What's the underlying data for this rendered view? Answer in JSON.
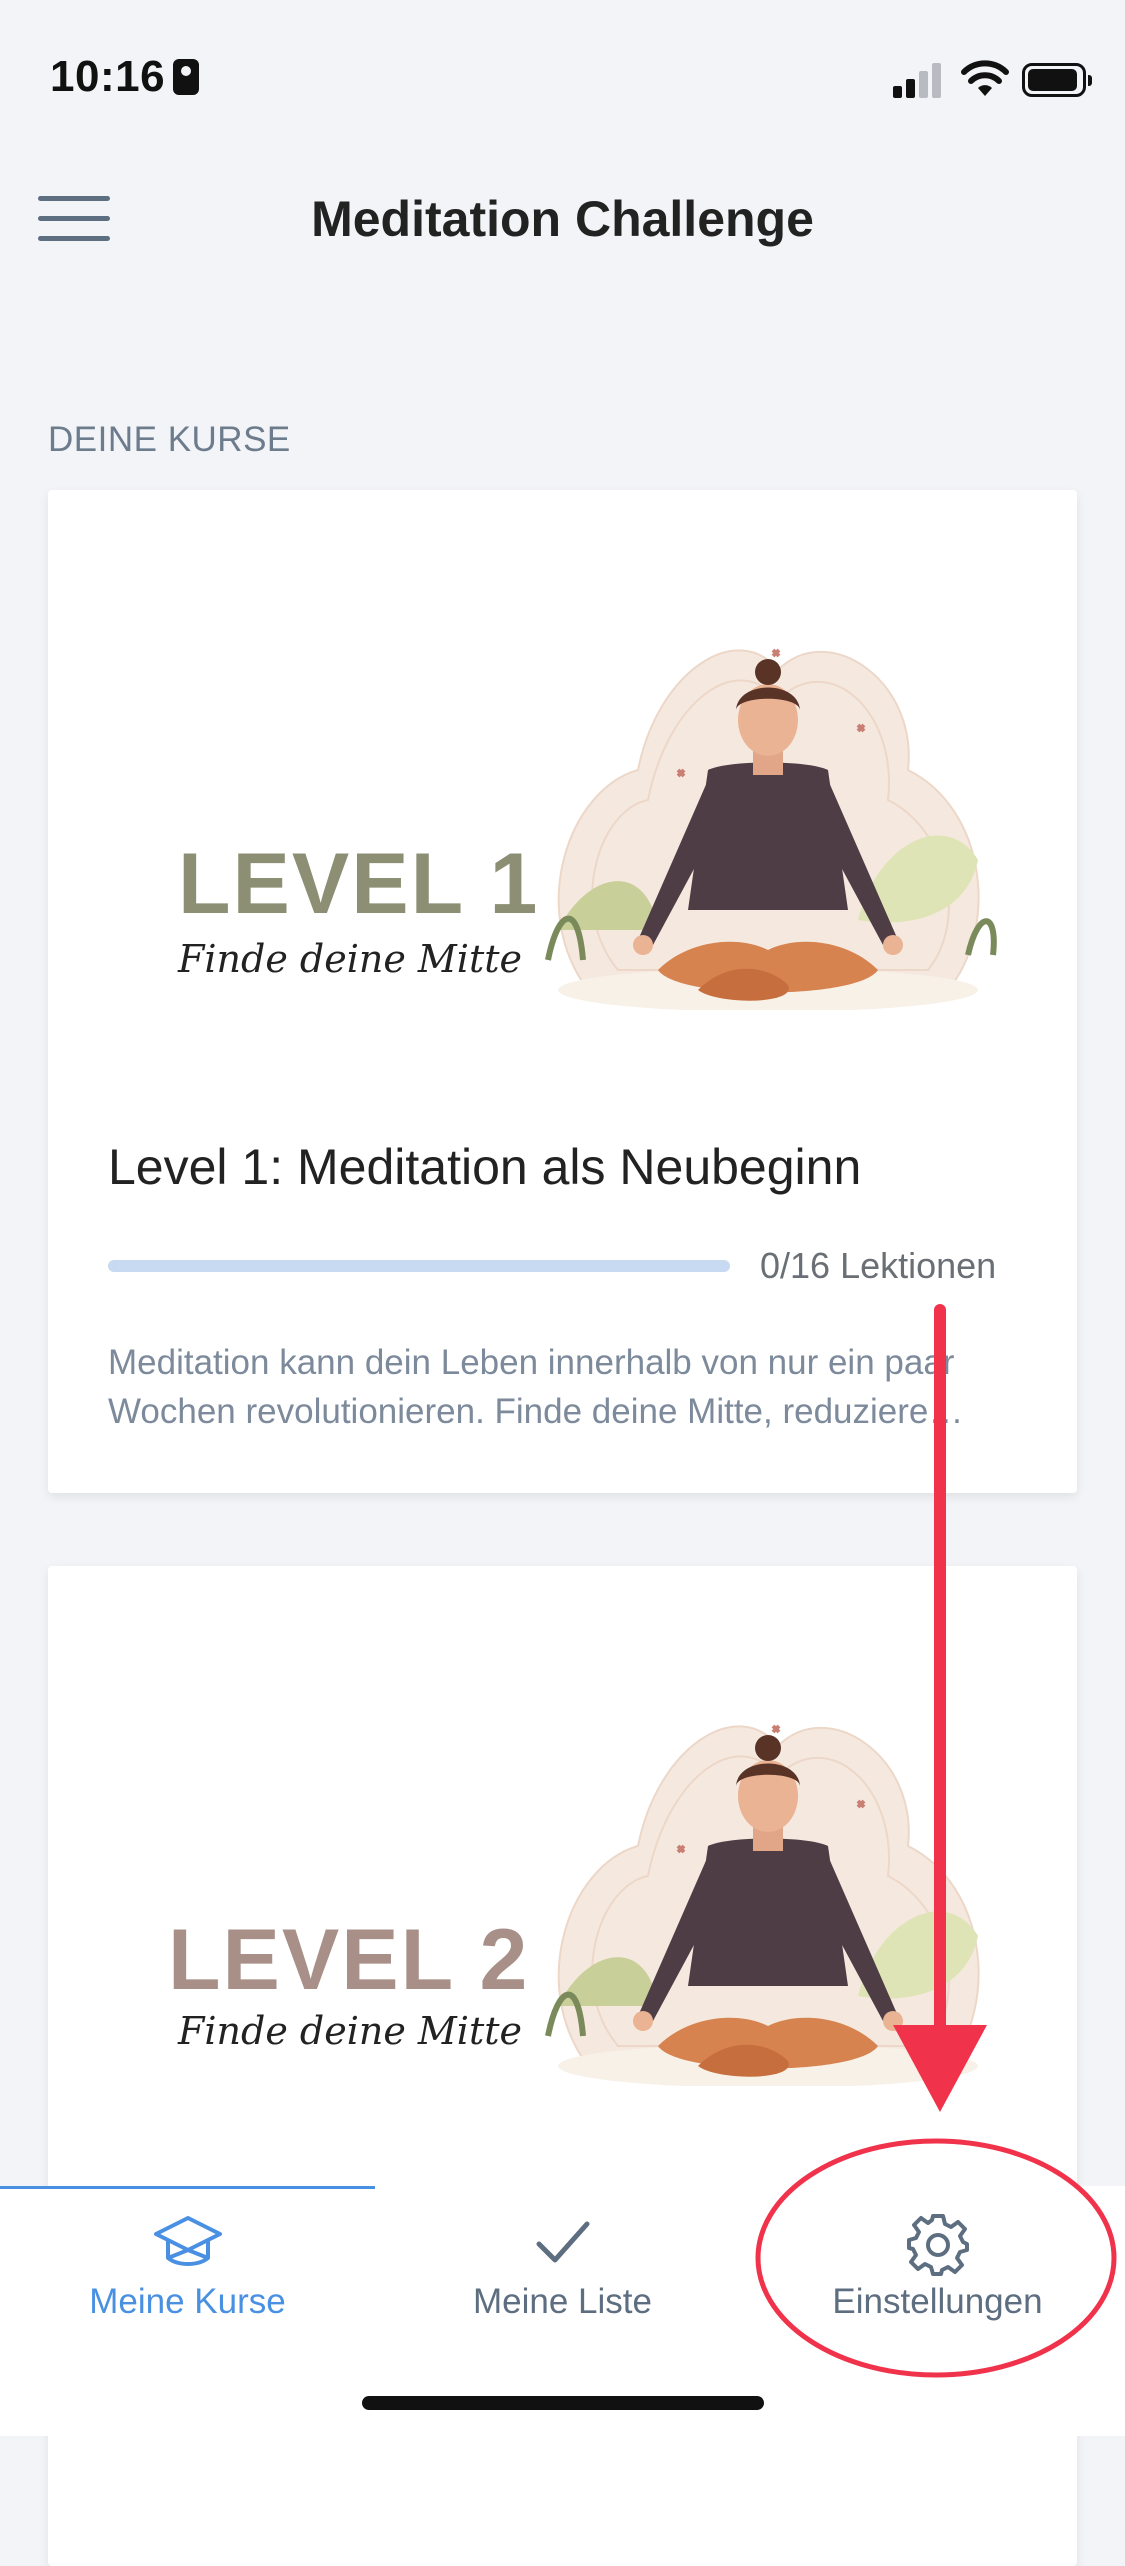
{
  "status_bar": {
    "time": "10:16"
  },
  "header": {
    "title": "Meditation Challenge"
  },
  "section": {
    "label": "DEINE KURSE"
  },
  "courses": [
    {
      "image_level": "LEVEL 1",
      "image_subtitle": "Finde deine Mitte",
      "level_color": "#8c8f74",
      "title": "Level 1: Meditation als Neubeginn",
      "progress_text": "0/16 Lektionen",
      "progress_fraction": 0,
      "description": "Meditation kann dein Leben innerhalb von nur ein paar Wochen revolutionieren. Finde deine Mitte, reduziere…"
    },
    {
      "image_level": "LEVEL 2",
      "image_subtitle": "Finde deine Mitte",
      "level_color": "#a89088"
    }
  ],
  "tabs": [
    {
      "label": "Meine Kurse",
      "icon": "graduation-cap-icon",
      "active": true
    },
    {
      "label": "Meine Liste",
      "icon": "checkmark-icon",
      "active": false
    },
    {
      "label": "Einstellungen",
      "icon": "gear-icon",
      "active": false
    }
  ],
  "colors": {
    "accent": "#4a90e2",
    "inactive_tab": "#5d6e80",
    "annotation": "#f0324b",
    "background": "#f2f4f7"
  }
}
